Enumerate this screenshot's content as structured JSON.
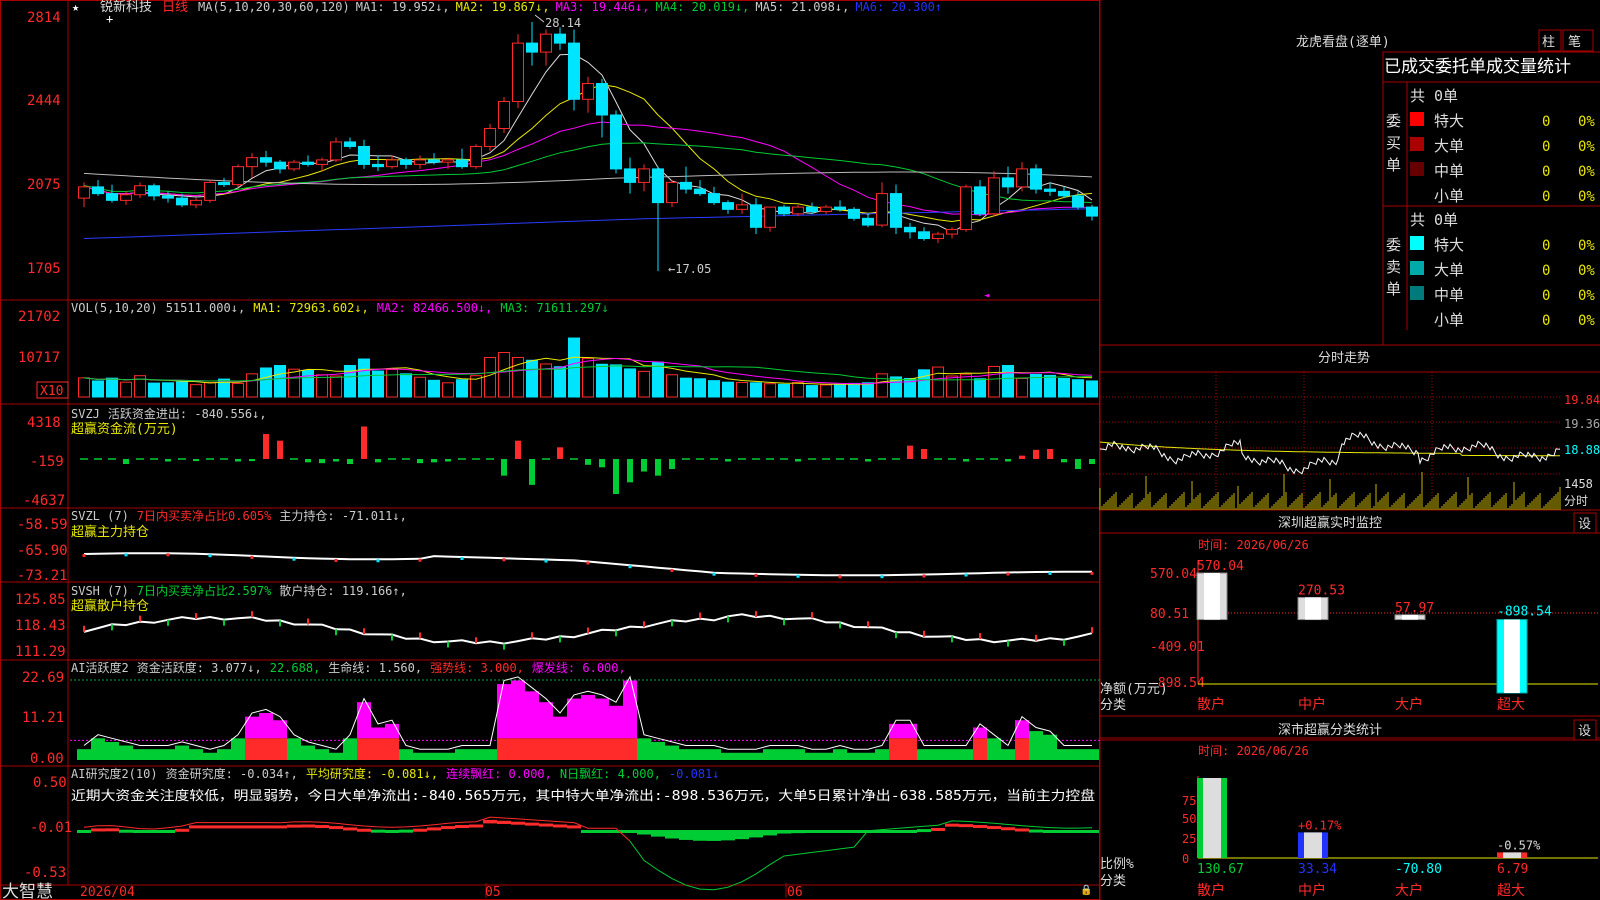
{
  "app": {
    "logo": "大智慧",
    "stock_name": "锐新科技",
    "period": "日线",
    "star": "★"
  },
  "colors": {
    "up": "#ff2a2a",
    "down": "#00e5ff",
    "green": "#00cc33",
    "yellow": "#e8e800",
    "magenta": "#ff00ff",
    "frame": "#a80000",
    "bg": "#000000"
  },
  "main": {
    "ma_header": [
      {
        "text": "MA(5,10,20,30,60,120)",
        "color": "#cccccc"
      },
      {
        "text": "MA1: 19.952↓,",
        "color": "#cccccc"
      },
      {
        "text": "MA2: 19.867↓,",
        "color": "#e8e800"
      },
      {
        "text": "MA3: 19.446↓,",
        "color": "#ff00ff"
      },
      {
        "text": "MA4: 20.019↓,",
        "color": "#00cc33"
      },
      {
        "text": "MA5: 21.098↓,",
        "color": "#cccccc"
      },
      {
        "text": "MA6: 20.300↑",
        "color": "#2233ff"
      }
    ],
    "price_labels": [
      "2814",
      "2444",
      "2075",
      "1705"
    ],
    "high_marker": "28.14",
    "low_marker": "←17.05"
  },
  "vol": {
    "header": [
      {
        "text": "VOL(5,10,20)",
        "color": "#cccccc"
      },
      {
        "text": "51511.000↓,",
        "color": "#cccccc"
      },
      {
        "text": "MA1: 72963.602↓,",
        "color": "#e8e800"
      },
      {
        "text": "MA2: 82466.500↓,",
        "color": "#ff00ff"
      },
      {
        "text": "MA3: 71611.297↓",
        "color": "#00cc33"
      }
    ],
    "labels": [
      "21702",
      "10717"
    ],
    "unit": "X10"
  },
  "svzj": {
    "header": [
      {
        "text": "SVZJ",
        "color": "#cccccc"
      },
      {
        "text": "活跃资金进出: -840.556↓,",
        "color": "#cccccc"
      }
    ],
    "subtitle": "超赢资金流(万元)",
    "labels": [
      "4318",
      "-159",
      "-4637"
    ]
  },
  "svzl": {
    "header": [
      {
        "text": "SVZL (7)",
        "color": "#cccccc"
      },
      {
        "text": "7日内买卖净占比0.605%",
        "color": "#ff2a2a"
      },
      {
        "text": "主力持仓: -71.011↓,",
        "color": "#cccccc"
      }
    ],
    "subtitle": "超赢主力持仓",
    "labels": [
      "-58.59",
      "-65.90",
      "-73.21"
    ]
  },
  "svsh": {
    "header": [
      {
        "text": "SVSH (7)",
        "color": "#cccccc"
      },
      {
        "text": "7日内买卖净占比2.597%",
        "color": "#00cc33"
      },
      {
        "text": "散户持仓: 119.166↑,",
        "color": "#cccccc"
      }
    ],
    "subtitle": "超赢散户持仓",
    "labels": [
      "125.85",
      "118.43",
      "111.29"
    ]
  },
  "ai1": {
    "header": [
      {
        "text": "AI活跃度2",
        "color": "#cccccc"
      },
      {
        "text": "资金活跃度: 3.077↓,",
        "color": "#cccccc"
      },
      {
        "text": "22.688,",
        "color": "#00cc33"
      },
      {
        "text": "生命线: 1.560,",
        "color": "#cccccc"
      },
      {
        "text": "强势线: 3.000,",
        "color": "#ff2a2a"
      },
      {
        "text": "爆发线: 6.000,",
        "color": "#ff00ff"
      }
    ],
    "labels": [
      "22.69",
      "11.21",
      "0.00"
    ]
  },
  "ai2": {
    "header": [
      {
        "text": "AI研究度2(10)",
        "color": "#cccccc"
      },
      {
        "text": "资金研究度: -0.034↑,",
        "color": "#cccccc"
      },
      {
        "text": "平均研究度: -0.081↓,",
        "color": "#e8e800"
      },
      {
        "text": "连续飘红: 0.000,",
        "color": "#ff00ff"
      },
      {
        "text": "N日飘红: 4.000,",
        "color": "#00cc33"
      },
      {
        "text": "-0.081↓",
        "color": "#2233ff"
      }
    ],
    "commentary": "近期大资金关注度较低，明显弱势，今日大单净流出:-840.565万元，其中特大单净流出:-898.536万元，大单5日累计净出-638.585万元，当前主力控盘",
    "labels": [
      "0.50",
      "-0.01",
      "-0.53"
    ]
  },
  "xaxis": {
    "labels": [
      "2026/04",
      "05",
      "06"
    ]
  },
  "right": {
    "dragon_title": "龙虎看盘(逐单)",
    "btn_zhu": "柱",
    "btn_bi": "笔",
    "order_title": "已成交委托单成交量统计",
    "buy_side": {
      "label": "委买单",
      "total": "共 0单",
      "rows": [
        {
          "name": "特大",
          "count": "0",
          "pct": "0%",
          "color": "#ff0000"
        },
        {
          "name": "大单",
          "count": "0",
          "pct": "0%",
          "color": "#aa0000"
        },
        {
          "name": "中单",
          "count": "0",
          "pct": "0%",
          "color": "#660000"
        },
        {
          "name": "小单",
          "count": "0",
          "pct": "0%",
          "color": ""
        }
      ]
    },
    "sell_side": {
      "label": "委卖单",
      "total": "共 0单",
      "rows": [
        {
          "name": "特大",
          "count": "0",
          "pct": "0%",
          "color": "#00ffff"
        },
        {
          "name": "大单",
          "count": "0",
          "pct": "0%",
          "color": "#00aaaa"
        },
        {
          "name": "中单",
          "count": "0",
          "pct": "0%",
          "color": "#007a7a"
        },
        {
          "name": "小单",
          "count": "0",
          "pct": "0%",
          "color": ""
        }
      ]
    },
    "intraday_title": "分时走势",
    "intraday_labels": [
      "19.84",
      "19.36",
      "18.88"
    ],
    "intraday_vol_labels": [
      "1458",
      "分时"
    ],
    "monitor": {
      "title": "深圳超赢实时监控",
      "set_btn": "设",
      "time": "时间: 2026/06/26",
      "ylabels": [
        "570.04",
        "80.51",
        "-409.01",
        "-898.54"
      ],
      "unit": "净额(万元)",
      "cat_label": "分类",
      "bars": [
        {
          "name": "散户",
          "value": 570.04,
          "label": "570.04"
        },
        {
          "name": "中户",
          "value": 270.53,
          "label": "270.53"
        },
        {
          "name": "大户",
          "value": 57.97,
          "label": "57.97"
        },
        {
          "name": "超大",
          "value": -898.54,
          "label": "-898.54"
        }
      ]
    },
    "classify": {
      "title": "深市超赢分类统计",
      "set_btn": "设",
      "time": "时间: 2026/06/26",
      "ylabels": [
        "75",
        "50",
        "25",
        "0"
      ],
      "unit": "比例%",
      "cat_label": "分类",
      "items": [
        {
          "name": "散户",
          "value": "130.67",
          "ratio": 100,
          "pct": ""
        },
        {
          "name": "中户",
          "value": "33.34",
          "ratio": 32,
          "pct": "+0.17%"
        },
        {
          "name": "大户",
          "value": "-70.80",
          "ratio": 0,
          "pct": ""
        },
        {
          "name": "超大",
          "value": "6.79",
          "ratio": 7,
          "pct": "-0.57%"
        }
      ]
    }
  }
}
